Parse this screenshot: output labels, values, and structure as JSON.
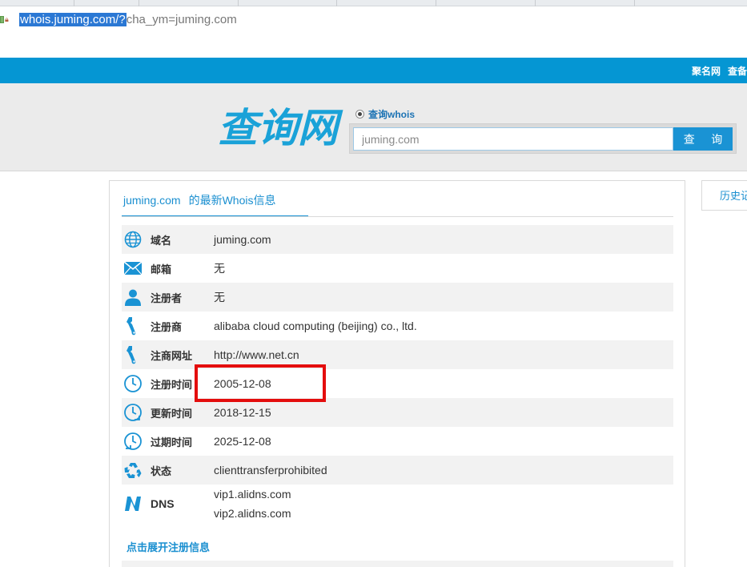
{
  "browser": {
    "url_selected": "whois.juming.com/?",
    "url_rest": "cha_ym=juming.com"
  },
  "site": {
    "top_links": [
      "聚名网",
      "查备"
    ]
  },
  "header": {
    "logo_text": "查询网",
    "radio_label": "查询whois",
    "search_value": "juming.com",
    "search_button": "查 询"
  },
  "panel": {
    "title_domain": "juming.com",
    "title_suffix": "的最新Whois信息",
    "rows": [
      {
        "icon": "globe-icon",
        "label": "域名",
        "values": [
          "juming.com"
        ]
      },
      {
        "icon": "mail-icon",
        "label": "邮箱",
        "values": [
          "无"
        ]
      },
      {
        "icon": "person-icon",
        "label": "注册者",
        "values": [
          "无"
        ]
      },
      {
        "icon": "tool-icon",
        "label": "注册商",
        "values": [
          "alibaba cloud computing (beijing) co., ltd."
        ]
      },
      {
        "icon": "tool-icon",
        "label": "注商网址",
        "values": [
          "http://www.net.cn"
        ]
      },
      {
        "icon": "clock-icon",
        "label": "注册时间",
        "values": [
          "2005-12-08"
        ]
      },
      {
        "icon": "clock-refresh-icon",
        "label": "更新时间",
        "values": [
          "2018-12-15"
        ]
      },
      {
        "icon": "clock-expire-icon",
        "label": "过期时间",
        "values": [
          "2025-12-08"
        ]
      },
      {
        "icon": "recycle-icon",
        "label": "状态",
        "values": [
          "clienttransferprohibited"
        ]
      },
      {
        "icon": "dns-icon",
        "label": "DNS",
        "values": [
          "vip1.alidns.com",
          "vip2.alidns.com"
        ]
      }
    ],
    "expand_link": "点击展开注册信息"
  },
  "history_tab": "历史记",
  "colors": {
    "brand_blue": "#0596d3",
    "link_blue": "#1a8fd0",
    "highlight_red": "#e40d0d"
  }
}
